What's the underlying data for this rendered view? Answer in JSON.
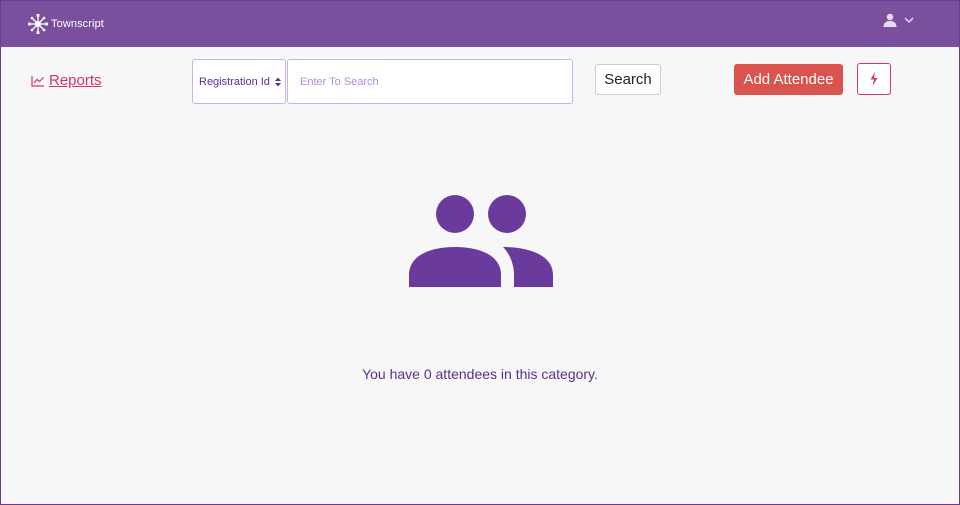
{
  "header": {
    "brand_name": "Townscript",
    "brand_color": "#7a4f9e"
  },
  "toolbar": {
    "reports_label": "Reports",
    "filter": {
      "selected": "Registration Id"
    },
    "search": {
      "placeholder": "Enter To Search",
      "value": ""
    },
    "search_button_label": "Search",
    "add_attendee_label": "Add Attendee"
  },
  "icons": {
    "brand_logo": "network-icon",
    "user": "user-icon",
    "user_menu_caret": "chevron-down-icon",
    "reports": "line-chart-icon",
    "quick_action": "bolt-icon",
    "empty_state": "users-icon"
  },
  "colors": {
    "accent": "#5d2d91",
    "link": "#d6336c",
    "primary_button": "#d9534f",
    "background": "#f7f7f7"
  },
  "empty_state": {
    "message": "You have 0 attendees in this category."
  }
}
